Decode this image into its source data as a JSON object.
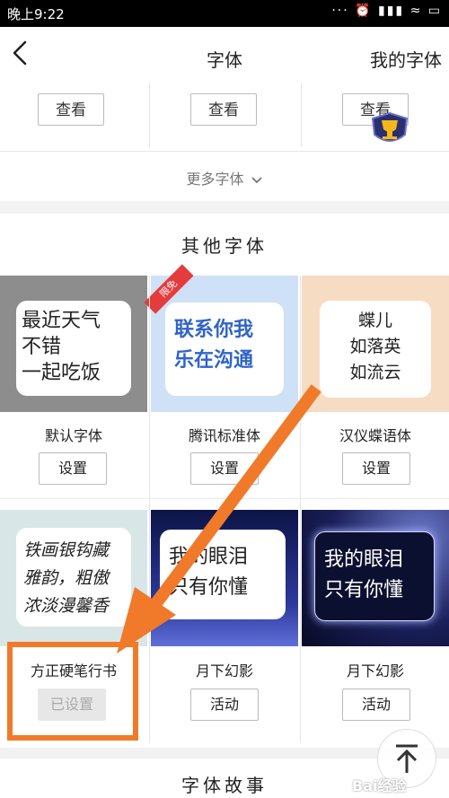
{
  "status_bar": {
    "time": "晚上9:22",
    "icons": "··· ⏰ ▮▮▮ ≈ ▭"
  },
  "header": {
    "title": "字体",
    "right_link": "我的字体"
  },
  "top_fonts": {
    "buttons": [
      "查看",
      "查看",
      "查看"
    ],
    "more": "更多字体"
  },
  "others": {
    "title": "其他字体",
    "tiles": [
      {
        "name": "默认字体",
        "preview": [
          "最近天气",
          "不错",
          "一起吃饭"
        ],
        "action": "设置"
      },
      {
        "name": "腾讯标准体",
        "preview": [
          "联系你我",
          "乐在沟通"
        ],
        "action": "设置",
        "tag": "限免"
      },
      {
        "name": "汉仪蝶语体",
        "preview": [
          "蝶儿",
          "如落英",
          "如流云"
        ],
        "action": "设置"
      },
      {
        "name": "方正硬笔行书",
        "preview": [
          "铁画银钩藏",
          "雅韵，粗傲",
          "浓淡漫馨香"
        ],
        "action": "已设置"
      },
      {
        "name": "月下幻影",
        "preview": [
          "我的眼泪",
          "只有你懂"
        ],
        "action": "活动"
      },
      {
        "name": "月下幻影",
        "preview": [
          "我的眼泪",
          "只有你懂"
        ],
        "action": "活动"
      }
    ]
  },
  "story": {
    "title": "字体故事"
  },
  "watermark": "Bai经验",
  "colors": {
    "annotation": "#f07a2a",
    "active_blue": "#2f64c8",
    "tag_red": "#e43c3c"
  },
  "icons": {
    "back": "chevron-left-icon",
    "more": "chevron-down-icon",
    "top": "arrow-up-to-top-icon",
    "badge": "trophy-badge-icon"
  }
}
